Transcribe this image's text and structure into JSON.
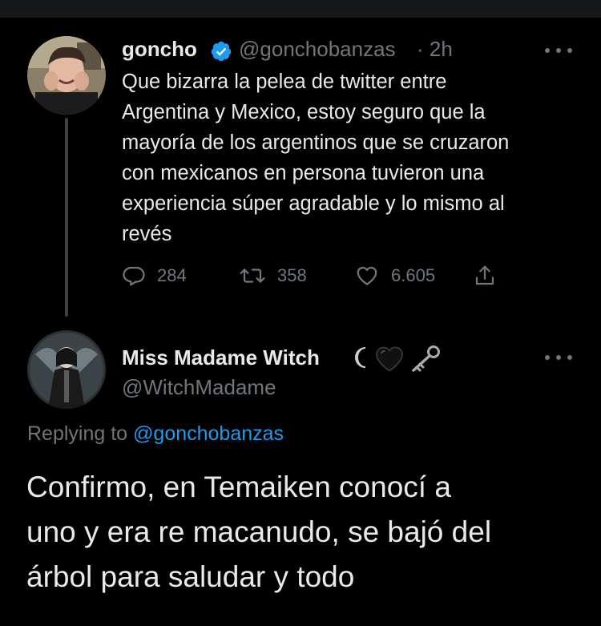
{
  "tweet": {
    "author_name": "goncho",
    "author_handle": "@gonchobanzas",
    "timestamp": "· 2h",
    "verified": true,
    "text_lines": [
      "Que bizarra la pelea de twitter entre",
      "Argentina y Mexico, estoy seguro que la",
      "mayoría de los argentinos que se cruzaron",
      "con mexicanos en persona tuvieron una",
      "experiencia súper agradable y lo mismo al",
      "revés"
    ],
    "replies": "284",
    "retweets": "358",
    "likes": "6.605"
  },
  "reply": {
    "author_name": "Miss Madame Witch",
    "name_emoji": [
      "crescent-moon",
      "black-heart",
      "old-key"
    ],
    "author_handle": "@WitchMadame",
    "replying_prefix": "Replying to",
    "replying_to": "@gonchobanzas",
    "text_lines": [
      "Confirmo, en Temaiken conocí a",
      "uno y era re macanudo, se bajó del",
      "árbol para saludar y todo"
    ]
  },
  "colors": {
    "background": "#000000",
    "text": "#e7e9ea",
    "secondary": "#71767b",
    "accent": "#1d9bf0",
    "thread_line": "#3d4145"
  }
}
